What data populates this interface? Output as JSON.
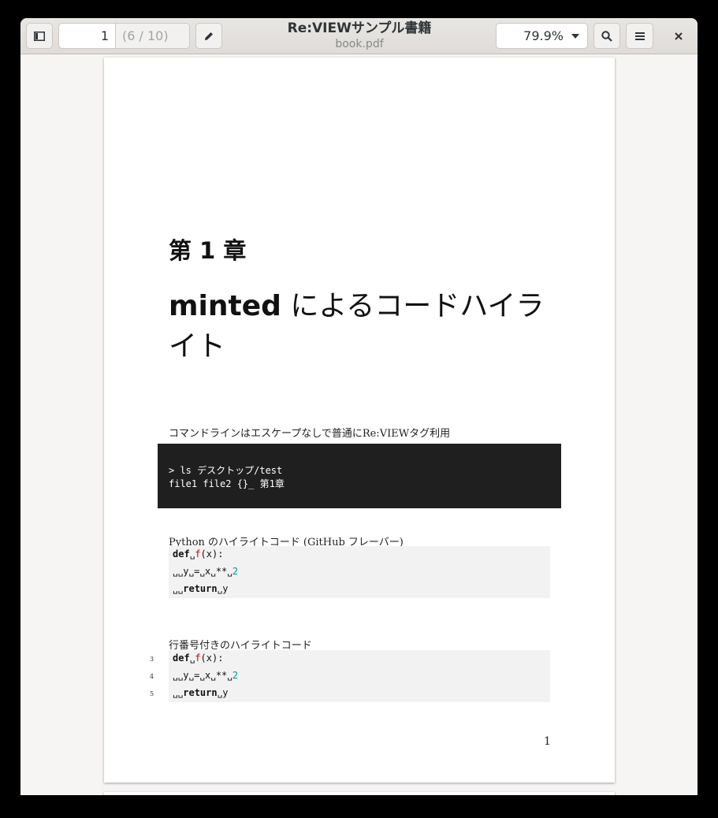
{
  "header": {
    "page_input": "1",
    "page_total": "(6 / 10)",
    "title": "Re:VIEWサンプル書籍",
    "subtitle": "book.pdf",
    "zoom": "79.9%"
  },
  "icons": [
    "sidebar-toggle-icon",
    "pencil-icon",
    "chevron-down-icon",
    "search-icon",
    "hamburger-menu-icon",
    "close-icon"
  ],
  "document": {
    "chapter_number": "第 1 章",
    "chapter_title_latin": "minted",
    "chapter_title_line1": " によるコードハイラ",
    "chapter_title_line2": "イト",
    "para_commandline": "コマンドラインはエスケープなしで普通にRe:VIEWタグ利用",
    "cmd_line1": "> ls デスクトップ/test",
    "cmd_line2": "file1  file2  {}_  第1章",
    "para_python": "Python のハイライトコード (GitHub フレーバー)",
    "code1": {
      "l1_kw": "def",
      "l1_fn": "f",
      "l1_rest": "(x):",
      "l2_a": "y",
      "l2_b": "=",
      "l2_c": "x",
      "l2_d": "**",
      "l2_num": "2",
      "l3_kw": "return",
      "l3_rest": "y"
    },
    "para_lineno": "行番号付きのハイライトコード",
    "line_numbers": [
      "3",
      "4",
      "5"
    ],
    "folio": "1"
  }
}
